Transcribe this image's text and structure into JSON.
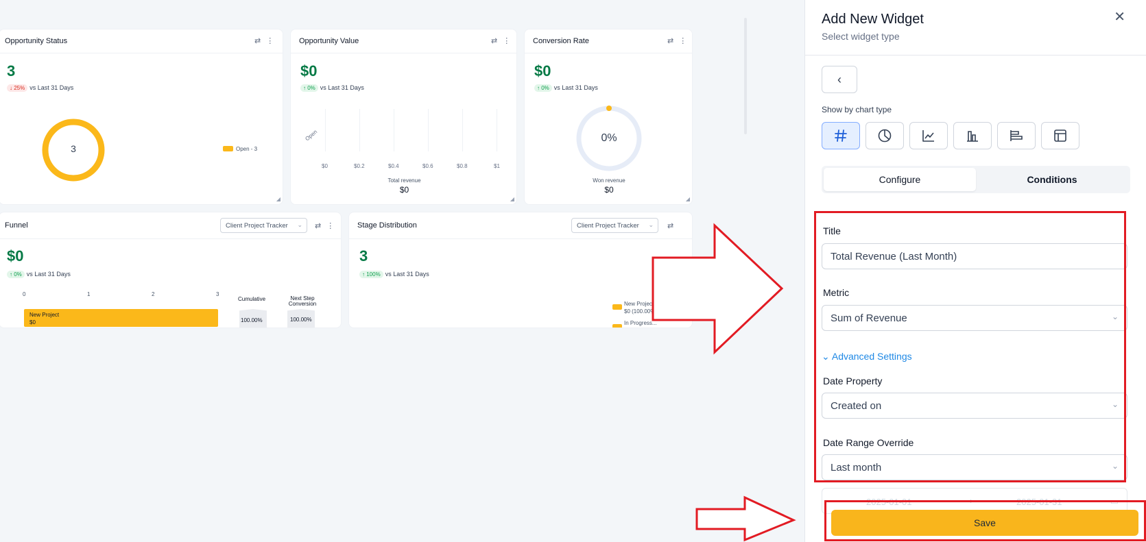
{
  "cards": {
    "opp_status": {
      "title": "Opportunity Status",
      "value": "3",
      "delta": "↓ 25%",
      "delta_text": "vs Last 31 Days",
      "center": "3",
      "legend": "Open - 3",
      "ring_color": "#fbb81a"
    },
    "opp_value": {
      "title": "Opportunity Value",
      "value": "$0",
      "delta": "↑ 0%",
      "delta_text": "vs Last 31 Days",
      "y_label": "Open",
      "x_ticks": [
        "$0",
        "$0.2",
        "$0.4",
        "$0.6",
        "$0.8",
        "$1"
      ],
      "caption": "Total revenue",
      "caption_value": "$0"
    },
    "conversion": {
      "title": "Conversion Rate",
      "value": "$0",
      "delta": "↑ 0%",
      "delta_text": "vs Last 31 Days",
      "center": "0%",
      "caption": "Won revenue",
      "caption_value": "$0"
    },
    "funnel": {
      "title": "Funnel",
      "select": "Client Project Tracker",
      "value": "$0",
      "delta": "↑ 0%",
      "delta_text": "vs Last 31 Days",
      "axis": [
        "0",
        "1",
        "2",
        "3"
      ],
      "bar_label": "New Project",
      "bar_value": "$0",
      "col1": "Cumulative",
      "col2": "Next Step Conversion",
      "pct1": "100.00%",
      "pct2": "100.00%"
    },
    "stage": {
      "title": "Stage Distribution",
      "select": "Client Project Tracker",
      "value": "3",
      "delta": "↑ 100%",
      "delta_text": "vs Last 31 Days",
      "legend1": "New Project...",
      "legend1_sub": "$0 (100.00%) - 3",
      "legend2": "In Progress..."
    }
  },
  "panel": {
    "title": "Add New Widget",
    "subtitle": "Select widget type",
    "show_by": "Show by chart type",
    "chart_types": [
      "number-icon",
      "pie-icon",
      "line-chart-icon",
      "bar-chart-icon",
      "horizontal-bar-icon",
      "table-icon"
    ],
    "tabs": [
      "Configure",
      "Conditions"
    ],
    "title_label": "Title",
    "title_value": "Total Revenue (Last Month)",
    "metric_label": "Metric",
    "metric_value": "Sum of Revenue",
    "advanced": "Advanced Settings",
    "date_prop_label": "Date Property",
    "date_prop_value": "Created on",
    "date_range_label": "Date Range Override",
    "date_range_value": "Last month",
    "date_from": "2025-01-01",
    "date_to": "2025-01-31",
    "save": "Save"
  },
  "colors": {
    "accent": "#f9b51c",
    "positive": "#067a46",
    "highlight": "#e21b23",
    "link": "#1e88e5"
  }
}
